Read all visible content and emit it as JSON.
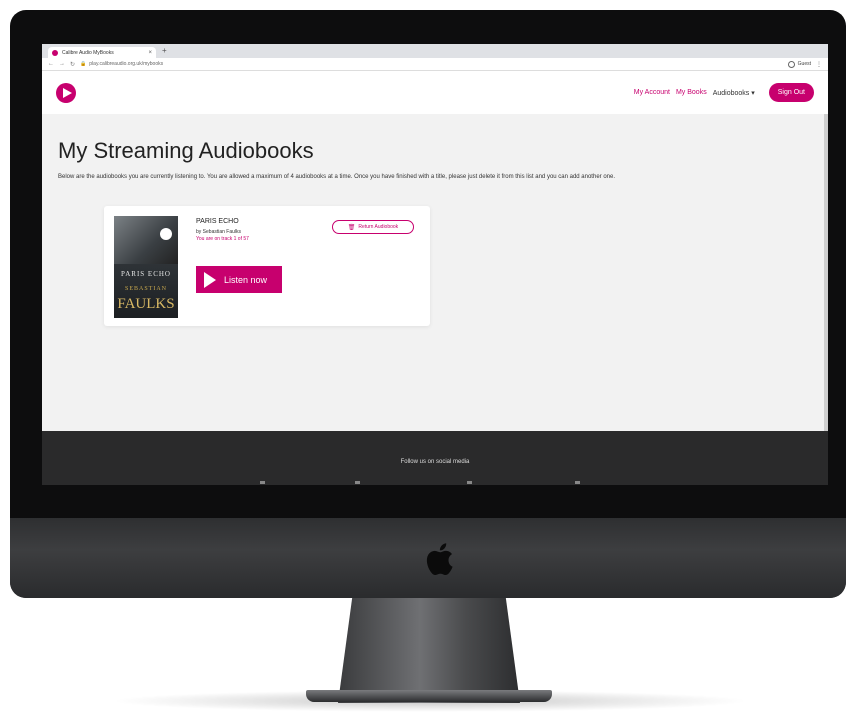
{
  "browser": {
    "tab_title": "Calibre Audio MyBooks",
    "tab_close": "×",
    "new_tab": "+",
    "url": "play.calibreaudio.org.uk/mybooks",
    "profile": "Guest"
  },
  "site": {
    "nav": {
      "my_account": "My Account",
      "my_books": "My Books",
      "audiobooks": "Audiobooks ▾"
    },
    "sign_out": "Sign Out"
  },
  "main": {
    "title": "My Streaming Audiobooks",
    "intro": "Below are the audiobooks you are currently listening to. You are allowed a maximum of 4 audiobooks at a time. Once you have finished with a title, please just delete it from this list and you can add another one.",
    "book": {
      "title": "PARIS ECHO",
      "author": "by Sebastian Faulks",
      "track": "You are on track 1 of 57",
      "return_label": "Return Audiobook",
      "listen_label": "Listen now",
      "cover_title": "PARIS ECHO",
      "cover_author_first": "SEBASTIAN",
      "cover_author_last": "FAULKS"
    }
  },
  "footer": {
    "text": "Follow us on social media"
  },
  "colors": {
    "brand": "#c7006e",
    "footer_bg": "#2a2a2b"
  }
}
